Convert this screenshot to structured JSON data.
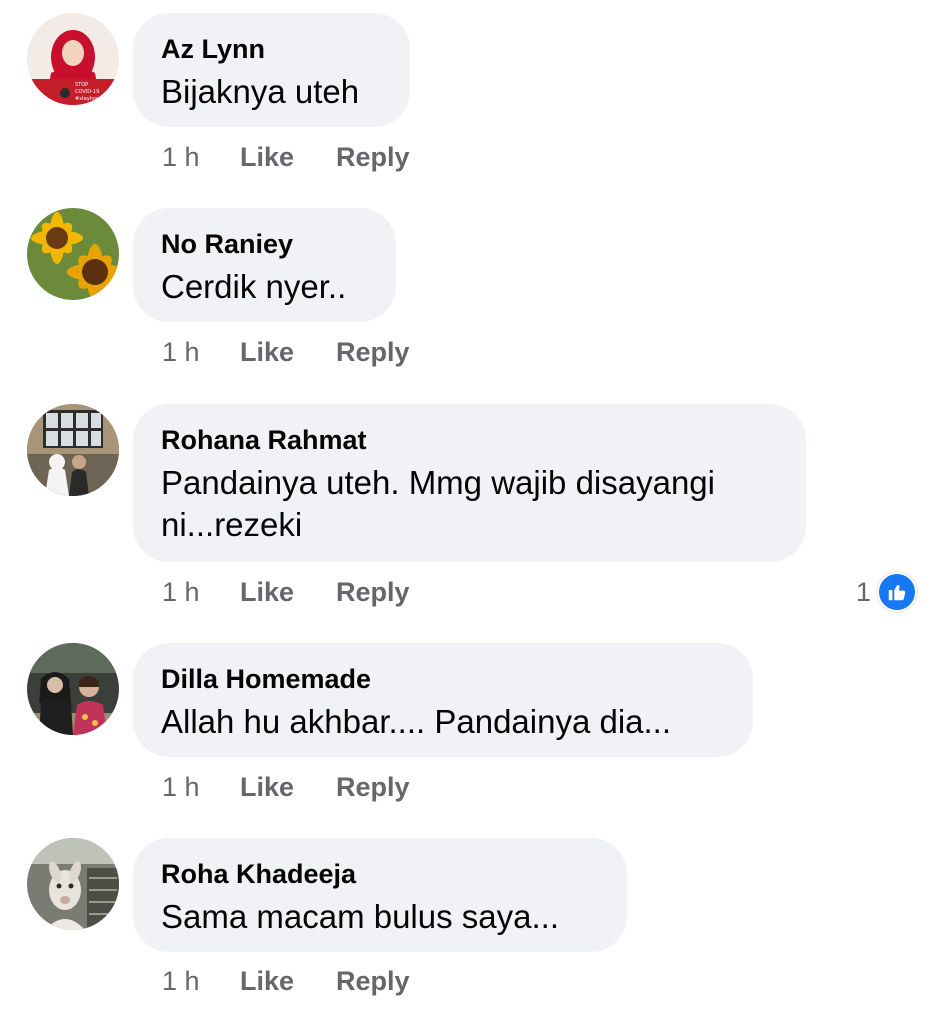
{
  "comments": [
    {
      "author": "Az Lynn",
      "text": "Bijaknya uteh",
      "avatar_caption": "STOP COVID-19 #stayhome",
      "time": "1 h",
      "like_label": "Like",
      "reply_label": "Reply"
    },
    {
      "author": "No Raniey",
      "text": "Cerdik nyer..",
      "time": "1 h",
      "like_label": "Like",
      "reply_label": "Reply"
    },
    {
      "author": "Rohana Rahmat",
      "text": "Pandainya uteh. Mmg wajib disayangi ni...rezeki",
      "time": "1 h",
      "like_label": "Like",
      "reply_label": "Reply",
      "reaction_count": "1",
      "reaction_icon": "thumbs-up-icon"
    },
    {
      "author": "Dilla Homemade",
      "text": "Allah hu akhbar.... Pandainya dia...",
      "time": "1 h",
      "like_label": "Like",
      "reply_label": "Reply"
    },
    {
      "author": "Roha Khadeeja",
      "text": "Sama macam bulus saya...",
      "time": "1 h",
      "like_label": "Like",
      "reply_label": "Reply"
    }
  ],
  "colors": {
    "bubble_bg": "#f0f2f5",
    "secondary_text": "#65676b",
    "like_blue": "#1877f2"
  }
}
